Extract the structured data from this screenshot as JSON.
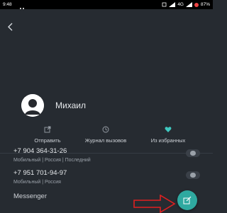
{
  "status_bar": {
    "time": "9:48",
    "network": "4G",
    "battery": "87%"
  },
  "contact": {
    "name": "Михаил"
  },
  "actions": [
    {
      "label": "Отправить",
      "icon": "share-icon"
    },
    {
      "label": "Журнал вызовов",
      "icon": "clock-icon"
    },
    {
      "label": "Из избранных",
      "icon": "heart-icon"
    }
  ],
  "phones": [
    {
      "number": "+7 904 364-31-26",
      "meta": "Мобильный | Россия | Последний"
    },
    {
      "number": "+7 951 701-94-97",
      "meta": "Мобильный | Россия"
    }
  ],
  "messenger": {
    "label": "Messenger"
  },
  "colors": {
    "background": "#262b31",
    "accent": "#2fa9a0",
    "favorite": "#3fc9c0",
    "annotation_arrow": "#e02020"
  }
}
